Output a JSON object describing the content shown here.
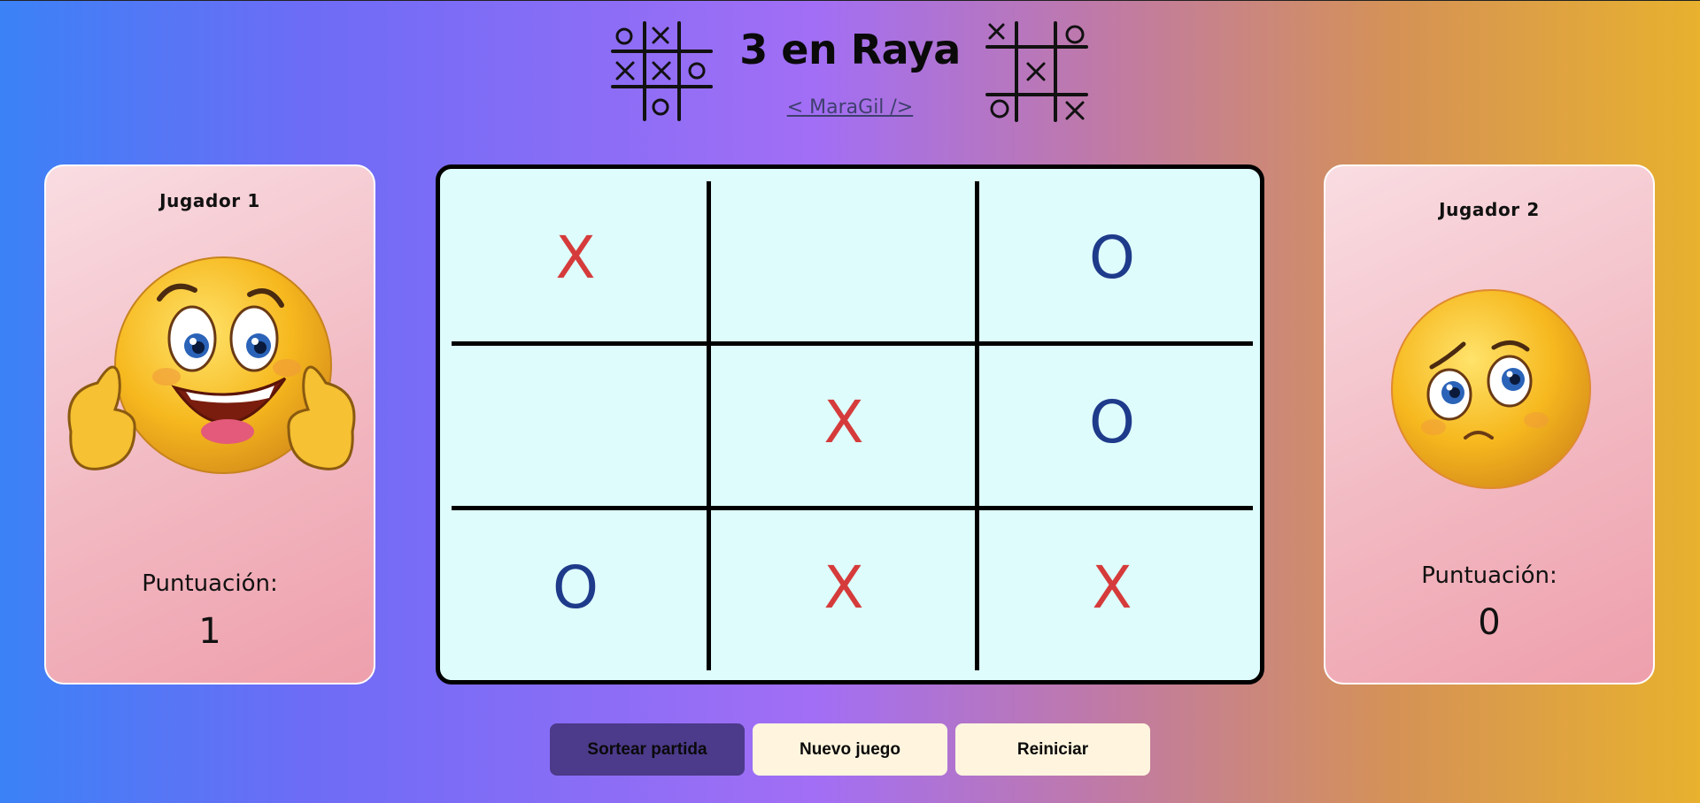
{
  "header": {
    "title": "3 en Raya",
    "author": "< MaraGil />"
  },
  "players": [
    {
      "name": "Jugador 1",
      "score_label": "Puntuación:",
      "score": "1",
      "emoji": "happy-thumbs-up-emoji"
    },
    {
      "name": "Jugador 2",
      "score_label": "Puntuación:",
      "score": "0",
      "emoji": "worried-emoji"
    }
  ],
  "board": {
    "cells": [
      "X",
      "",
      "O",
      "",
      "X",
      "O",
      "O",
      "X",
      "X"
    ]
  },
  "buttons": {
    "draw": "Sortear partida",
    "new_game": "Nuevo juego",
    "reset": "Reiniciar"
  },
  "colors": {
    "x_mark": "#d63b3b",
    "o_mark": "#1e3a8a",
    "board_bg": "#defcfc",
    "card_bg": "#f2b9c2",
    "primary_button": "#4c3a8a",
    "secondary_button": "#fff5de"
  }
}
